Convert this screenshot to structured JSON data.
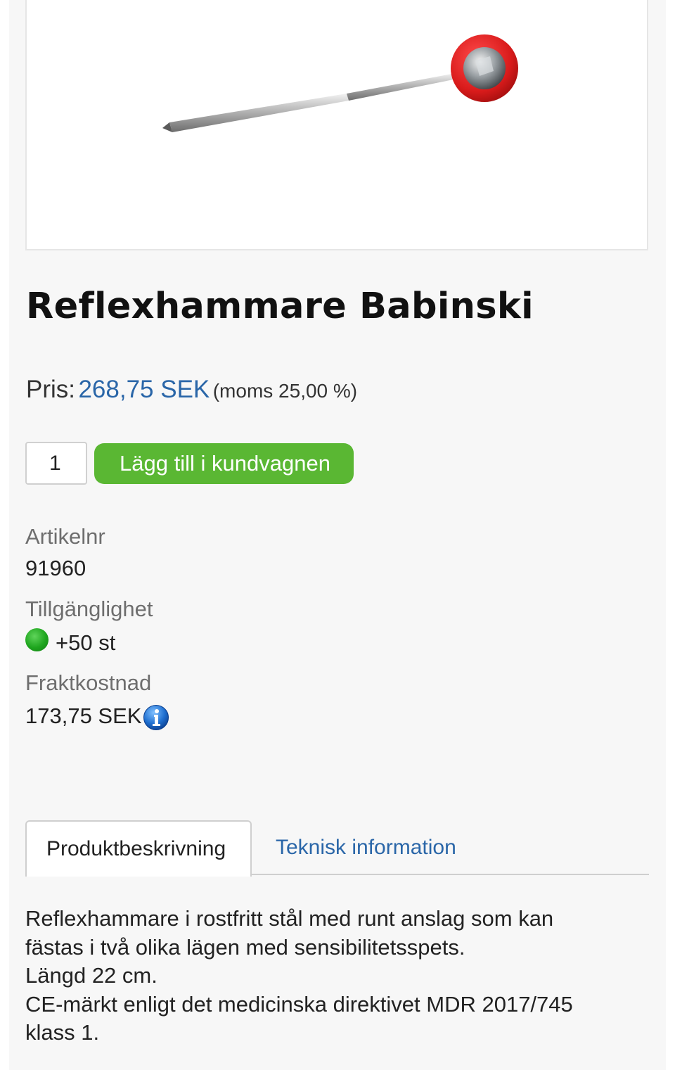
{
  "product": {
    "image_alt": "Reflexhammare Babinski",
    "title": "Reflexhammare Babinski",
    "price_label": "Pris:",
    "price_value": "268,75 SEK",
    "price_vat": "(moms 25,00 %)"
  },
  "cart": {
    "quantity": "1",
    "add_button_label": "Lägg till i kundvagnen",
    "button_color": "#5ab733"
  },
  "attributes": {
    "article_label": "Artikelnr",
    "article_value": "91960",
    "availability_label": "Tillgänglighet",
    "availability_value": "+50 st",
    "availability_icon": "green-dot-icon",
    "shipping_label": "Fraktkostnad",
    "shipping_value": "173,75 SEK",
    "shipping_icon": "info-icon"
  },
  "tabs": [
    {
      "label": "Produktbeskrivning",
      "active": true
    },
    {
      "label": "Teknisk information",
      "active": false
    }
  ],
  "description": {
    "lines": [
      "Reflexhammare i rostfritt stål med runt anslag som kan",
      "fästas i två olika lägen med sensibilitetsspets.",
      "Längd 22 cm.",
      "CE-märkt enligt det medicinska direktivet MDR 2017/745",
      "klass 1."
    ]
  },
  "colors": {
    "accent_blue": "#2a66a8",
    "add_green": "#5ab733",
    "availability_green": "#1ea51e"
  }
}
